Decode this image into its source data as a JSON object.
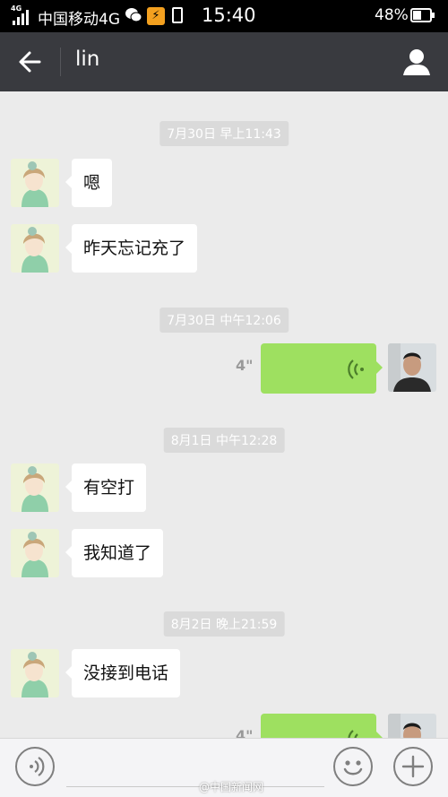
{
  "status_bar": {
    "network": "4G",
    "carrier": "中国移动4G",
    "time": "15:40",
    "battery": "48%"
  },
  "header": {
    "title": "lin"
  },
  "chat": {
    "timestamps": [
      "7月30日 早上11:43",
      "7月30日 中午12:06",
      "8月1日 中午12:28",
      "8月2日 晚上21:59"
    ],
    "messages": [
      "嗯",
      "昨天忘记充了",
      "有空打",
      "我知道了",
      "没接到电话"
    ],
    "voice_messages": [
      {
        "duration": "4\""
      },
      {
        "duration": "4\""
      }
    ]
  },
  "watermark": "@中国新闻网",
  "colors": {
    "header_bg": "#393a3f",
    "voice_bubble": "#9ee060",
    "chat_bg": "#ebebeb"
  },
  "icons": [
    "back-arrow-icon",
    "contact-icon",
    "voice-wave-icon",
    "emoji-icon",
    "plus-icon"
  ]
}
